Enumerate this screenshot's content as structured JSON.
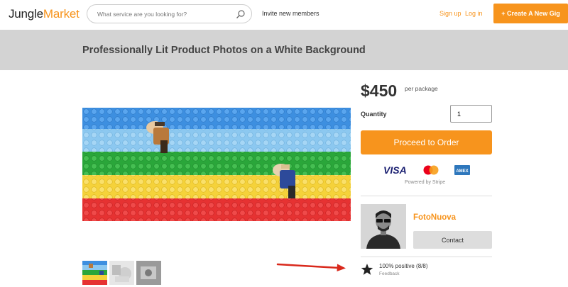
{
  "header": {
    "logo_part1": "Jungle",
    "logo_part2": "Market",
    "search_placeholder": "What service are you looking for?",
    "invite_label": "Invite new members",
    "signup_label": "Sign up",
    "login_label": "Log in",
    "create_label": "+ Create A New Gig"
  },
  "banner": {
    "title": "Professionally Lit Product Photos on a White Background"
  },
  "order": {
    "price": "$450",
    "per_package": "per package",
    "quantity_label": "Quantity",
    "quantity_value": "1",
    "proceed_label": "Proceed to Order",
    "powered_by": "Powered by Stripe",
    "visa_label": "VISA",
    "amex_label": "AMEX"
  },
  "seller": {
    "name": "FotoNuova",
    "contact_label": "Contact"
  },
  "feedback": {
    "positive": "100% positive (8/8)",
    "label": "Feedback"
  },
  "colors": {
    "accent": "#f7941d",
    "banner_bg": "#d3d3d3"
  },
  "icons": [
    "search-icon",
    "visa-icon",
    "mastercard-icon",
    "amex-icon",
    "star-icon",
    "red-arrow"
  ]
}
